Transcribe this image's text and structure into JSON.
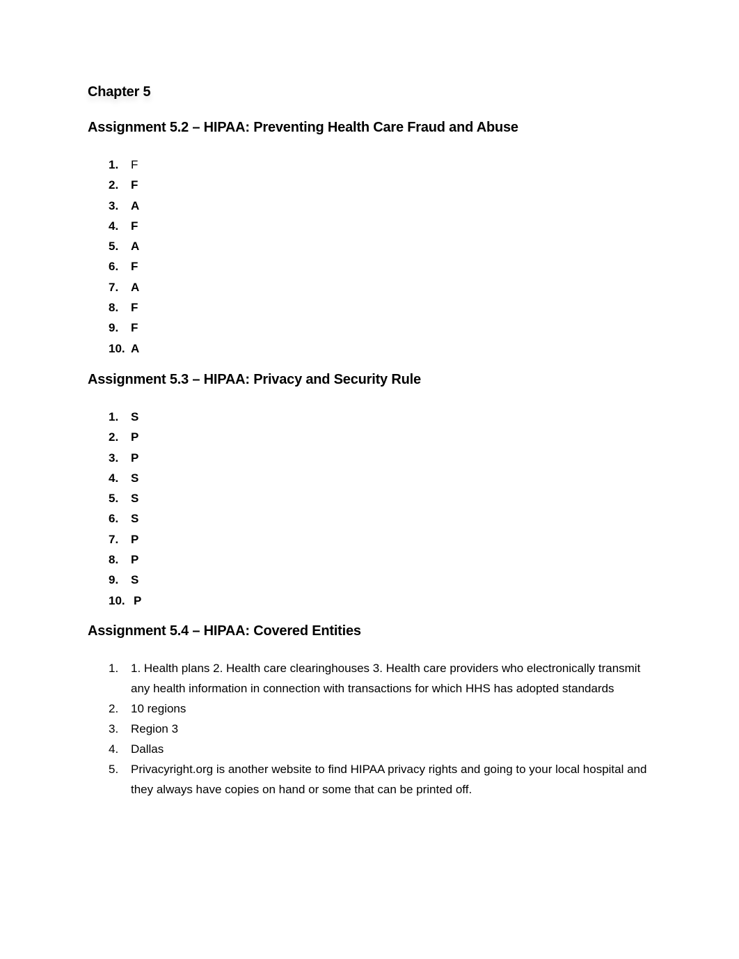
{
  "chapter_title": "Chapter 5",
  "sections": [
    {
      "heading": "Assignment 5.2 – HIPAA: Preventing Health Care Fraud and Abuse",
      "items": [
        {
          "num": "1.",
          "value": "F"
        },
        {
          "num": "2.",
          "value": "F"
        },
        {
          "num": "3.",
          "value": "A"
        },
        {
          "num": "4.",
          "value": "F"
        },
        {
          "num": "5.",
          "value": "A"
        },
        {
          "num": "6.",
          "value": "F"
        },
        {
          "num": "7.",
          "value": "A"
        },
        {
          "num": "8.",
          "value": "F"
        },
        {
          "num": "9.",
          "value": "F"
        },
        {
          "num": "10.",
          "value": "A"
        }
      ]
    },
    {
      "heading": "Assignment 5.3 – HIPAA: Privacy and Security Rule",
      "items": [
        {
          "num": "1.",
          "value": "S"
        },
        {
          "num": "2.",
          "value": "P"
        },
        {
          "num": "3.",
          "value": "P"
        },
        {
          "num": "4.",
          "value": "S"
        },
        {
          "num": "5.",
          "value": "S"
        },
        {
          "num": "6.",
          "value": "S"
        },
        {
          "num": "7.",
          "value": "P"
        },
        {
          "num": "8.",
          "value": "P"
        },
        {
          "num": "9.",
          "value": "S"
        },
        {
          "num": "10.",
          "value": "P"
        }
      ]
    },
    {
      "heading": "Assignment 5.4 – HIPAA: Covered Entities",
      "items": [
        {
          "num": "1.",
          "value": "1. Health plans 2. Health care clearinghouses 3. Health care providers who electronically transmit any health information in connection with transactions for which HHS has adopted standards"
        },
        {
          "num": "2.",
          "value": "10 regions"
        },
        {
          "num": "3.",
          "value": "Region 3"
        },
        {
          "num": "4.",
          "value": "Dallas"
        },
        {
          "num": "5.",
          "value": "Privacyright.org is another website to find HIPAA privacy rights and going to your local hospital and they always have copies on hand or some that can be printed off."
        }
      ]
    }
  ]
}
